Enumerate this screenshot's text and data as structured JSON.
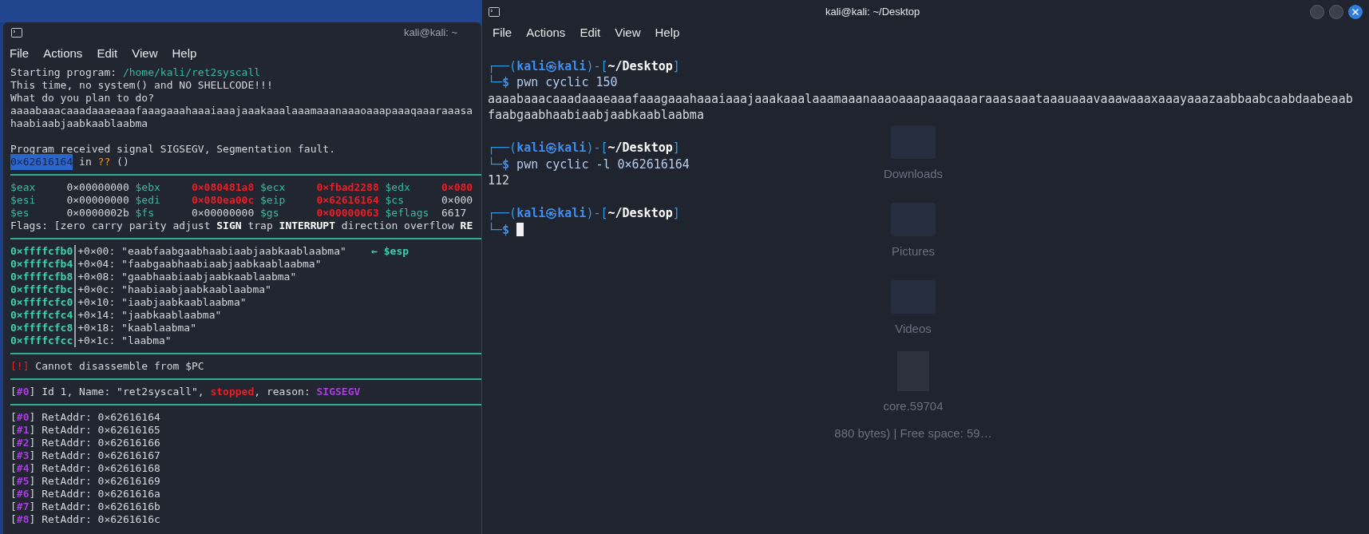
{
  "left_terminal": {
    "title": "kali@kali: ~",
    "menu": [
      "File",
      "Actions",
      "Edit",
      "View",
      "Help"
    ],
    "content": [
      {
        "kind": "text",
        "segments": [
          {
            "text": "Starting program: ",
            "kind": "plain"
          },
          {
            "text": "/home/kali/ret2syscall",
            "kind": "teal"
          }
        ]
      },
      {
        "kind": "text",
        "segments": [
          {
            "text": "This time, no system() and NO SHELLCODE!!!",
            "kind": "plain"
          }
        ]
      },
      {
        "kind": "text",
        "segments": [
          {
            "text": "What do you plan to do?",
            "kind": "plain"
          }
        ]
      },
      {
        "kind": "text",
        "segments": [
          {
            "text": "aaaabaaacaaadaaaeaaafaaagaaahaaaiaaajaaakaaalaaamaaanaaaoaaapaaaqaaaraaasa",
            "kind": "plain"
          }
        ]
      },
      {
        "kind": "text",
        "segments": [
          {
            "text": "haabiaabjaabkaablaabma",
            "kind": "plain"
          }
        ]
      },
      {
        "kind": "blank"
      },
      {
        "kind": "text",
        "segments": [
          {
            "text": "Program received signal SIGSEGV, Segmentation fault.",
            "kind": "plain"
          }
        ]
      },
      {
        "kind": "text",
        "segments": [
          {
            "text": "0×62616164",
            "kind": "hl"
          },
          {
            "text": " in ",
            "kind": "plain"
          },
          {
            "text": "??",
            "kind": "orange"
          },
          {
            "text": " ()",
            "kind": "plain"
          }
        ]
      },
      {
        "kind": "rule"
      },
      {
        "kind": "registers",
        "rows": [
          [
            {
              "name": "$eax",
              "value": "0×00000000",
              "changed": false
            },
            {
              "name": "$ebx",
              "value": "0×080481a8",
              "changed": true
            },
            {
              "name": "$ecx",
              "value": "0×fbad2288",
              "changed": true
            },
            {
              "name": "$edx",
              "value": "0×080",
              "changed": true
            }
          ],
          [
            {
              "name": "$esi",
              "value": "0×00000000",
              "changed": false
            },
            {
              "name": "$edi",
              "value": "0×080ea00c",
              "changed": true
            },
            {
              "name": "$eip",
              "value": "0×62616164",
              "changed": true
            },
            {
              "name": "$cs",
              "value": "0×000",
              "changed": false
            }
          ],
          [
            {
              "name": "$es",
              "value": "0×0000002b",
              "changed": false
            },
            {
              "name": "$fs",
              "value": "0×00000000",
              "changed": false
            },
            {
              "name": "$gs",
              "value": "0×00000063",
              "changed": true
            },
            {
              "name": "$eflags",
              "value": "6617",
              "changed": false
            }
          ]
        ]
      },
      {
        "kind": "text",
        "segments": [
          {
            "text": "Flags: [zero carry parity adjust ",
            "kind": "plain"
          },
          {
            "text": "SIGN",
            "kind": "bold"
          },
          {
            "text": " trap ",
            "kind": "plain"
          },
          {
            "text": "INTERRUPT",
            "kind": "bold"
          },
          {
            "text": " direction overflow ",
            "kind": "plain"
          },
          {
            "text": "RE",
            "kind": "bold"
          }
        ]
      },
      {
        "kind": "rule"
      },
      {
        "kind": "stack",
        "rows": [
          {
            "address": "0×ffffcfb0",
            "offset": "+0×00:",
            "value": "\"eaabfaabgaabhaabiaabjaabkaablaabma\"",
            "note": "← $esp"
          },
          {
            "address": "0×ffffcfb4",
            "offset": "+0×04:",
            "value": "\"faabgaabhaabiaabjaabkaablaabma\""
          },
          {
            "address": "0×ffffcfb8",
            "offset": "+0×08:",
            "value": "\"gaabhaabiaabjaabkaablaabma\""
          },
          {
            "address": "0×ffffcfbc",
            "offset": "+0×0c:",
            "value": "\"haabiaabjaabkaablaabma\""
          },
          {
            "address": "0×ffffcfc0",
            "offset": "+0×10:",
            "value": "\"iaabjaabkaablaabma\""
          },
          {
            "address": "0×ffffcfc4",
            "offset": "+0×14:",
            "value": "\"jaabkaablaabma\""
          },
          {
            "address": "0×ffffcfc8",
            "offset": "+0×18:",
            "value": "\"kaablaabma\""
          },
          {
            "address": "0×ffffcfcc",
            "offset": "+0×1c:",
            "value": "\"laabma\""
          }
        ]
      },
      {
        "kind": "rule"
      },
      {
        "kind": "text",
        "segments": [
          {
            "text": "[!]",
            "kind": "red"
          },
          {
            "text": " Cannot disassemble from $PC",
            "kind": "plain"
          }
        ]
      },
      {
        "kind": "rule"
      },
      {
        "kind": "text",
        "segments": [
          {
            "text": "[",
            "kind": "plain"
          },
          {
            "text": "#0",
            "kind": "purplebold"
          },
          {
            "text": "] Id 1, Name: \"ret2syscall\", ",
            "kind": "plain"
          },
          {
            "text": "stopped",
            "kind": "redbold"
          },
          {
            "text": ", reason: ",
            "kind": "plain"
          },
          {
            "text": "SIGSEGV",
            "kind": "purplebold"
          }
        ]
      },
      {
        "kind": "rule"
      },
      {
        "kind": "text",
        "segments": [
          {
            "text": "[",
            "kind": "plain"
          },
          {
            "text": "#0",
            "kind": "purplebold"
          },
          {
            "text": "] RetAddr: 0×62616164",
            "kind": "plain"
          }
        ]
      },
      {
        "kind": "text",
        "segments": [
          {
            "text": "[",
            "kind": "plain"
          },
          {
            "text": "#1",
            "kind": "purplebold"
          },
          {
            "text": "] RetAddr: 0×62616165",
            "kind": "plain"
          }
        ]
      },
      {
        "kind": "text",
        "segments": [
          {
            "text": "[",
            "kind": "plain"
          },
          {
            "text": "#2",
            "kind": "purplebold"
          },
          {
            "text": "] RetAddr: 0×62616166",
            "kind": "plain"
          }
        ]
      },
      {
        "kind": "text",
        "segments": [
          {
            "text": "[",
            "kind": "plain"
          },
          {
            "text": "#3",
            "kind": "purplebold"
          },
          {
            "text": "] RetAddr: 0×62616167",
            "kind": "plain"
          }
        ]
      },
      {
        "kind": "text",
        "segments": [
          {
            "text": "[",
            "kind": "plain"
          },
          {
            "text": "#4",
            "kind": "purplebold"
          },
          {
            "text": "] RetAddr: 0×62616168",
            "kind": "plain"
          }
        ]
      },
      {
        "kind": "text",
        "segments": [
          {
            "text": "[",
            "kind": "plain"
          },
          {
            "text": "#5",
            "kind": "purplebold"
          },
          {
            "text": "] RetAddr: 0×62616169",
            "kind": "plain"
          }
        ]
      },
      {
        "kind": "text",
        "segments": [
          {
            "text": "[",
            "kind": "plain"
          },
          {
            "text": "#6",
            "kind": "purplebold"
          },
          {
            "text": "] RetAddr: 0×6261616a",
            "kind": "plain"
          }
        ]
      },
      {
        "kind": "text",
        "segments": [
          {
            "text": "[",
            "kind": "plain"
          },
          {
            "text": "#7",
            "kind": "purplebold"
          },
          {
            "text": "] RetAddr: 0×6261616b",
            "kind": "plain"
          }
        ]
      },
      {
        "kind": "text",
        "segments": [
          {
            "text": "[",
            "kind": "plain"
          },
          {
            "text": "#8",
            "kind": "purplebold"
          },
          {
            "text": "] RetAddr: 0×6261616c",
            "kind": "plain"
          }
        ]
      }
    ]
  },
  "right_terminal": {
    "title": "kali@kali: ~/Desktop",
    "menu": [
      "File",
      "Actions",
      "Edit",
      "View",
      "Help"
    ],
    "desktop_behind": [
      "Downloads",
      "Pictures",
      "Videos",
      "core.59704"
    ],
    "status_behind": "880 bytes) | Free space: 59…",
    "content": [
      {
        "kind": "blank"
      },
      {
        "kind": "text",
        "segments": [
          {
            "text": "┌──(",
            "kind": "blue"
          },
          {
            "text": "kali㉿kali",
            "kind": "bluebold"
          },
          {
            "text": ")-[",
            "kind": "blue"
          },
          {
            "text": "~/Desktop",
            "kind": "bold"
          },
          {
            "text": "]",
            "kind": "blue"
          }
        ]
      },
      {
        "kind": "text",
        "segments": [
          {
            "text": "└─",
            "kind": "blue"
          },
          {
            "text": "$",
            "kind": "bluebold"
          },
          {
            "text": " pwn cyclic 150",
            "kind": "cmd"
          }
        ]
      },
      {
        "kind": "text",
        "segments": [
          {
            "text": "aaaabaaacaaadaaaeaaafaaagaaahaaaiaaajaaakaaalaaamaaanaaaoaaapaaaqaaaraaasaaataaauaaavaaawaaaxaaayaaazaabbaabcaabdaabeaab",
            "kind": "plain"
          }
        ]
      },
      {
        "kind": "text",
        "segments": [
          {
            "text": "faabgaabhaabiaabjaabkaablaabma",
            "kind": "plain"
          }
        ]
      },
      {
        "kind": "blank"
      },
      {
        "kind": "text",
        "segments": [
          {
            "text": "┌──(",
            "kind": "blue"
          },
          {
            "text": "kali㉿kali",
            "kind": "bluebold"
          },
          {
            "text": ")-[",
            "kind": "blue"
          },
          {
            "text": "~/Desktop",
            "kind": "bold"
          },
          {
            "text": "]",
            "kind": "blue"
          }
        ]
      },
      {
        "kind": "text",
        "segments": [
          {
            "text": "└─",
            "kind": "blue"
          },
          {
            "text": "$",
            "kind": "bluebold"
          },
          {
            "text": " pwn cyclic -l 0×62616164",
            "kind": "cmd"
          }
        ]
      },
      {
        "kind": "text",
        "segments": [
          {
            "text": "112",
            "kind": "plain"
          }
        ]
      },
      {
        "kind": "blank"
      },
      {
        "kind": "text",
        "segments": [
          {
            "text": "┌──(",
            "kind": "blue"
          },
          {
            "text": "kali㉿kali",
            "kind": "bluebold"
          },
          {
            "text": ")-[",
            "kind": "blue"
          },
          {
            "text": "~/Desktop",
            "kind": "bold"
          },
          {
            "text": "]",
            "kind": "blue"
          }
        ]
      },
      {
        "kind": "text",
        "cursor": true,
        "segments": [
          {
            "text": "└─",
            "kind": "blue"
          },
          {
            "text": "$",
            "kind": "bluebold"
          }
        ]
      }
    ]
  }
}
